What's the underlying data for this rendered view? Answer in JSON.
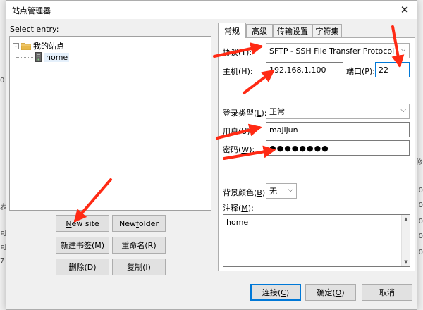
{
  "dialog": {
    "title": "站点管理器",
    "close_symbol": "✕",
    "select_entry_label": "Select entry:"
  },
  "tree": {
    "root": {
      "expander": "-",
      "label": "我的站点"
    },
    "child": {
      "label": "home"
    }
  },
  "left_buttons": {
    "new_site": {
      "pre": "",
      "u": "N",
      "post": "ew site"
    },
    "new_folder": {
      "pre": "New ",
      "u": "f",
      "post": "older"
    },
    "new_bookmark": {
      "pre": "新建书签(",
      "u": "M",
      "post": ")"
    },
    "rename": {
      "pre": "重命名(",
      "u": "R",
      "post": ")"
    },
    "delete": {
      "pre": "删除(",
      "u": "D",
      "post": ")"
    },
    "copy": {
      "pre": "复制(",
      "u": "I",
      "post": ")"
    }
  },
  "tabs": [
    "常规",
    "高级",
    "传输设置",
    "字符集"
  ],
  "general": {
    "protocol_label": {
      "pre": "协议(",
      "u": "T",
      "post": "):"
    },
    "protocol_value": "SFTP - SSH File Transfer Protocol",
    "host_label": {
      "pre": "主机(",
      "u": "H",
      "post": "):"
    },
    "host_value": "192.168.1.100",
    "port_label": {
      "pre": "端口(",
      "u": "P",
      "post": "):"
    },
    "port_value": "22",
    "logon_label": {
      "pre": "登录类型(",
      "u": "L",
      "post": "):"
    },
    "logon_value": "正常",
    "user_label": {
      "pre": "用户(",
      "u": "U",
      "post": "):"
    },
    "user_value": "majijun",
    "password_label": {
      "pre": "密码(",
      "u": "W",
      "post": "):"
    },
    "password_value": "●●●●●●●●",
    "bgcolor_label": {
      "pre": "背景颜色(",
      "u": "B",
      "post": ")"
    },
    "bgcolor_value": "无",
    "comments_label": {
      "pre": "注释(",
      "u": "M",
      "post": "):"
    },
    "comments_value": "home"
  },
  "bottom_buttons": {
    "connect": {
      "pre": "连接(",
      "u": "C",
      "post": ")"
    },
    "ok": {
      "pre": "确定(",
      "u": "O",
      "post": ")"
    },
    "cancel": "取消"
  },
  "background": {
    "left_glyphs": [
      "0",
      "表",
      "可",
      "可",
      "7"
    ],
    "right_glyphs": [
      "修",
      "0",
      "0",
      "0",
      "0",
      "0"
    ]
  },
  "colors": {
    "arrow": "#ff2a14",
    "selection": "#0078d7",
    "folder": "#e8b84a"
  }
}
